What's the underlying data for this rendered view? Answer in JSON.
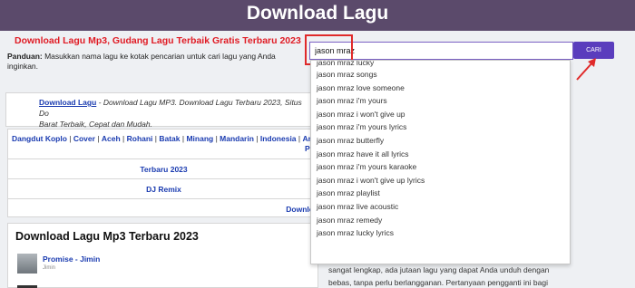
{
  "header": {
    "title": "Download Lagu"
  },
  "tagline": "Download Lagu Mp3, Gudang Lagu Terbaik Gratis Terbaru 2023",
  "panduan": {
    "label": "Panduan:",
    "text": " Masukkan nama lagu ke kotak pencarian untuk cari lagu yang Anda inginkan."
  },
  "search": {
    "value": "jason mraz",
    "button_label": "CARI"
  },
  "intro": {
    "link": "Download Lagu",
    "text1": " - Download Lagu MP3. Download Lagu Terbaru 2023, Situs Do",
    "text2": "Barat Terbaik, Cepat dan Mudah."
  },
  "categories": {
    "line1": [
      "Dangdut Koplo",
      "Cover",
      "Aceh",
      "Rohani",
      "Batak",
      "Minang",
      "Mandarin",
      "Indonesia",
      "Ana"
    ],
    "line2": "Po",
    "rows": [
      "Terbaru 2023",
      "DJ Remix",
      "Downlo"
    ]
  },
  "latest": {
    "heading": "Download Lagu Mp3 Terbaru 2023",
    "song": {
      "title": "Promise - Jimin",
      "artist": "Jimin"
    }
  },
  "suggestions": [
    "jason mraz lucky",
    "jason mraz songs",
    "jason mraz love someone",
    "jason mraz i'm yours",
    "jason mraz i won't give up",
    "jason mraz i'm yours lyrics",
    "jason mraz butterfly",
    "jason mraz have it all lyrics",
    "jason mraz i'm yours karaoke",
    "jason mraz i won't give up lyrics",
    "jason mraz playlist",
    "jason mraz live acoustic",
    "jason mraz remedy",
    "jason mraz lucky lyrics"
  ],
  "side_text": {
    "line1": "sangat lengkap, ada jutaan lagu yang dapat Anda unduh dengan",
    "line2": "bebas, tanpa perlu berlangganan. Pertanyaan pengganti ini bagi"
  },
  "colors": {
    "header_bg": "#5b4a6b",
    "accent": "#5a3dbd",
    "tagline": "#e01b24",
    "highlight": "#e02a2a",
    "link": "#1a3bb0"
  }
}
